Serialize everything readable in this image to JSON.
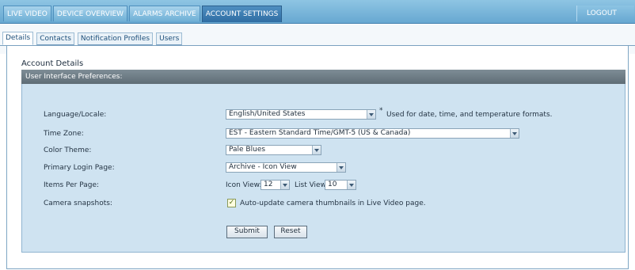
{
  "top_nav": {
    "tabs": [
      {
        "label": "LIVE VIDEO"
      },
      {
        "label": "DEVICE OVERVIEW"
      },
      {
        "label": "ALARMS ARCHIVE"
      },
      {
        "label": "ACCOUNT SETTINGS",
        "active": true
      }
    ],
    "logout_label": "LOGOUT"
  },
  "sub_tabs": [
    {
      "label": "Details",
      "active": true
    },
    {
      "label": "Contacts"
    },
    {
      "label": "Notification Profiles"
    },
    {
      "label": "Users"
    }
  ],
  "section_title": "Account Details",
  "panel": {
    "header": "User Interface Preferences:",
    "rows": {
      "language": {
        "label": "Language/Locale:",
        "value": "English/United States",
        "note": "Used for date, time, and temperature formats.",
        "asterisk": "*"
      },
      "timezone": {
        "label": "Time Zone:",
        "value": "EST - Eastern Standard Time/GMT-5 (US & Canada)"
      },
      "color_theme": {
        "label": "Color Theme:",
        "value": "Pale Blues"
      },
      "primary_login_page": {
        "label": "Primary Login Page:",
        "value": "Archive - Icon View"
      },
      "items_per_page": {
        "label": "Items Per Page:",
        "icon_view_label": "Icon View:",
        "icon_view_value": "12",
        "list_view_label": "List View:",
        "list_view_value": "10"
      },
      "camera_snapshots": {
        "label": "Camera snapshots:",
        "checked": true,
        "checkbox_label": "Auto-update camera thumbnails in Live Video page."
      }
    },
    "submit_label": "Submit",
    "reset_label": "Reset"
  },
  "colors": {
    "nav_gradient_top": "#8ec5e3",
    "nav_active": "#2f6da3",
    "panel_background": "#cfe3f1",
    "panel_header": "#6a7882"
  }
}
